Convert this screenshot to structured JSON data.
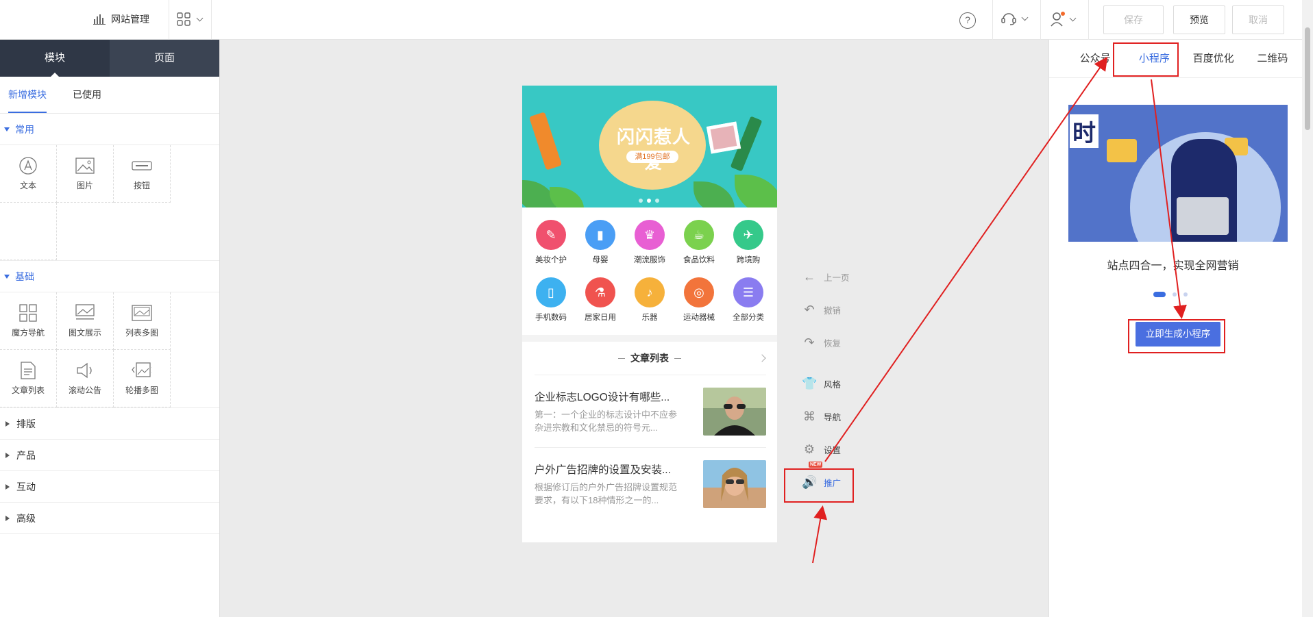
{
  "topbar": {
    "site_mgmt_label": "网站管理",
    "save_label": "保存",
    "preview_label": "预览",
    "cancel_label": "取消",
    "help_glyph": "?"
  },
  "left_panel": {
    "tabs": [
      "模块",
      "页面"
    ],
    "subtabs": [
      "新增模块",
      "已使用"
    ],
    "sections": [
      {
        "title": "常用",
        "items": [
          {
            "label": "文本",
            "icon": "text-icon"
          },
          {
            "label": "图片",
            "icon": "image-icon"
          },
          {
            "label": "按钮",
            "icon": "button-icon"
          }
        ]
      },
      {
        "title": "基础",
        "items": [
          {
            "label": "魔方导航",
            "icon": "cube-nav-icon"
          },
          {
            "label": "图文展示",
            "icon": "image-text-icon"
          },
          {
            "label": "列表多图",
            "icon": "list-images-icon"
          },
          {
            "label": "文章列表",
            "icon": "article-list-icon"
          },
          {
            "label": "滚动公告",
            "icon": "announcement-icon"
          },
          {
            "label": "轮播多图",
            "icon": "carousel-icon"
          }
        ]
      }
    ],
    "collapsed_sections": [
      "排版",
      "产品",
      "互动",
      "高级"
    ]
  },
  "phone": {
    "banner": {
      "title": "闪闪惹人爱",
      "promo": "满199包邮"
    },
    "categories": [
      {
        "label": "美妆个护",
        "color": "#f0506e",
        "glyph": "✎"
      },
      {
        "label": "母婴",
        "color": "#4a9ef5",
        "glyph": "▮"
      },
      {
        "label": "潮流服饰",
        "color": "#e85fd3",
        "glyph": "♛"
      },
      {
        "label": "食品饮料",
        "color": "#7bd14e",
        "glyph": "☕"
      },
      {
        "label": "跨境购",
        "color": "#35c98a",
        "glyph": "✈"
      },
      {
        "label": "手机数码",
        "color": "#3db1f0",
        "glyph": "▯"
      },
      {
        "label": "居家日用",
        "color": "#f0534f",
        "glyph": "⚗"
      },
      {
        "label": "乐器",
        "color": "#f6b13b",
        "glyph": "♪"
      },
      {
        "label": "运动器械",
        "color": "#f2743b",
        "glyph": "◎"
      },
      {
        "label": "全部分类",
        "color": "#8a7cf0",
        "glyph": "☰"
      }
    ],
    "article_section_title": "文章列表",
    "articles": [
      {
        "title": "企业标志LOGO设计有哪些...",
        "desc": "第一：一个企业的标志设计中不应参杂进宗教和文化禁忌的符号元..."
      },
      {
        "title": "户外广告招牌的设置及安装...",
        "desc": "根据修订后的户外广告招牌设置规范要求，有以下18种情形之一的..."
      }
    ]
  },
  "side_toolbar": {
    "prev_page": "上一页",
    "undo": "撤销",
    "redo": "恢复",
    "style": "风格",
    "nav": "导航",
    "settings": "设置",
    "promote": "推广",
    "new_tag": "NEW"
  },
  "right_panel": {
    "tabs": [
      "公众号",
      "小程序",
      "百度优化",
      "二维码"
    ],
    "active_tab": "小程序",
    "image_text": "时",
    "caption": "站点四合一，实现全网营销",
    "generate_button": "立即生成小程序"
  },
  "colors": {
    "accent": "#3a6de0",
    "annotation": "#e02020",
    "dark_header": "#3b4453"
  }
}
